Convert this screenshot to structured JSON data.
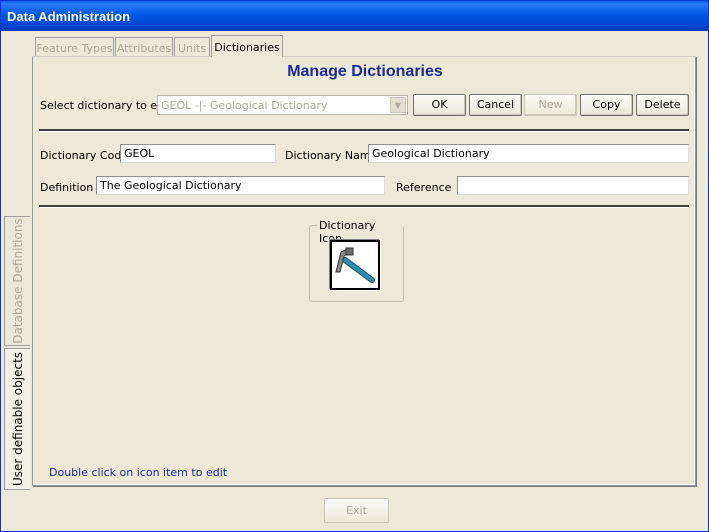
{
  "window": {
    "title": "Data Administration"
  },
  "side_tabs": [
    {
      "label": "Database Definitions",
      "active": false
    },
    {
      "label": "User definable objects",
      "active": true
    }
  ],
  "tabs": [
    {
      "label": "Feature Types",
      "active": false
    },
    {
      "label": "Attributes",
      "active": false
    },
    {
      "label": "Units",
      "active": false
    },
    {
      "label": "Dictionaries",
      "active": true
    }
  ],
  "panel": {
    "title": "Manage Dictionaries",
    "select_label": "Select dictionary to edit",
    "select_value": "GEOL -|- Geological Dictionary",
    "buttons": {
      "ok": "OK",
      "cancel": "Cancel",
      "new": "New",
      "copy": "Copy",
      "delete": "Delete"
    },
    "code_label": "Dictionary Code",
    "code_value": "GEOL",
    "name_label": "Dictionary Name",
    "name_value": "Geological Dictionary",
    "definition_label": "Definition",
    "definition_value": "The Geological Dictionary",
    "reference_label": "Reference",
    "reference_value": "",
    "icon_group_label": "Dictionary Icon",
    "icon_name": "geology-hammer-icon",
    "hint": "Double click on icon item to edit"
  },
  "footer": {
    "exit_label": "Exit"
  },
  "colors": {
    "title_bar": "#0058e6",
    "heading": "#1c2a9b",
    "hammer_handle": "#2a8fb0"
  }
}
